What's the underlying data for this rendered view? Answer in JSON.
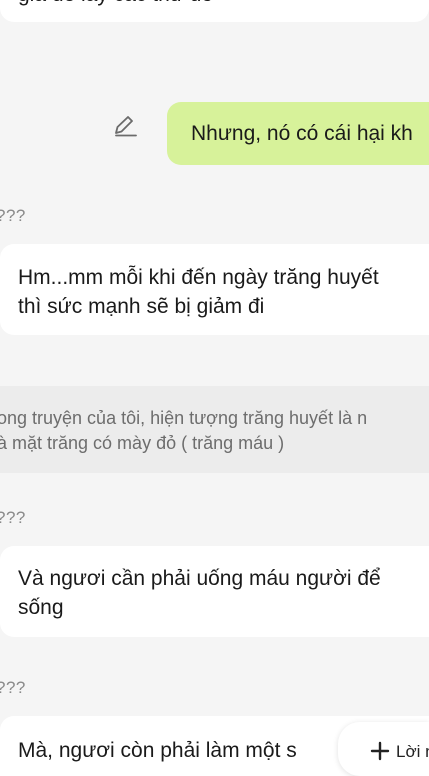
{
  "messages": [
    {
      "text": "giả để lấy các thứ đó"
    },
    {
      "user_text": "Nhưng, nó có cái hại kh",
      "edit_icon": "pencil-icon"
    },
    {
      "sender": "???",
      "lines": [
        "Hm...mm mỗi khi đến ngày trăng huyết",
        "thì sức mạnh sẽ bị giảm đi"
      ]
    },
    {
      "narration": [
        "ong truyện của tôi, hiện tượng trăng huyết là n",
        "à mặt trăng có mày đỏ ( trăng máu )"
      ]
    },
    {
      "sender": "???",
      "lines": [
        "Và ngươi cần phải uống máu người để",
        "sống"
      ]
    },
    {
      "sender": "???",
      "lines": [
        "Mà, ngươi còn phải làm một s"
      ]
    }
  ],
  "reply_button": {
    "label": "Lời n",
    "icon": "plus-icon"
  }
}
